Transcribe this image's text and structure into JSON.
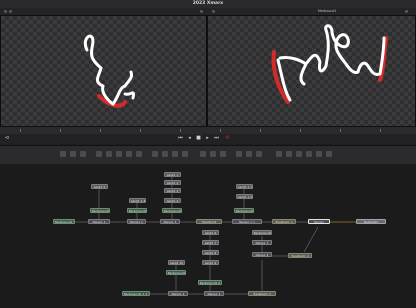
{
  "window": {
    "title": "2023 Xmarx"
  },
  "viewer2_label": "Mediaout1",
  "nodes": [
    {
      "id": "n1",
      "label": "paint1_1"
    },
    {
      "id": "n2",
      "label": "paint1_2"
    },
    {
      "id": "n3",
      "label": "paint1_3"
    },
    {
      "id": "n4",
      "label": "paint1_4"
    },
    {
      "id": "n5",
      "label": "paint1_5"
    },
    {
      "id": "n6",
      "label": "paint1_1_1"
    },
    {
      "id": "n7",
      "label": "paint1_1_2"
    },
    {
      "id": "n8",
      "label": "Background1_1"
    },
    {
      "id": "n9",
      "label": "Background1_2"
    },
    {
      "id": "n10",
      "label": "Background1_3"
    },
    {
      "id": "n11",
      "label": "Background1_4"
    },
    {
      "id": "n12",
      "label": "Background1_1_1"
    },
    {
      "id": "n13",
      "label": "Background1_1_1_1"
    },
    {
      "id": "n14",
      "label": "Merge1_1"
    },
    {
      "id": "n15",
      "label": "Merge1_2"
    },
    {
      "id": "n16",
      "label": "Merge1_3"
    },
    {
      "id": "n17",
      "label": "Merge1_1_1"
    },
    {
      "id": "n18",
      "label": "Transform1"
    },
    {
      "id": "n19",
      "label": "Transform1_1"
    },
    {
      "id": "n20",
      "label": "Merge1"
    },
    {
      "id": "n21",
      "label": "MediaOut1"
    },
    {
      "id": "n22",
      "label": "paint1_6"
    },
    {
      "id": "n23",
      "label": "paint1_7"
    },
    {
      "id": "n24",
      "label": "paint1_8"
    },
    {
      "id": "n25",
      "label": "paint1_9"
    },
    {
      "id": "n26",
      "label": "paint1_10"
    },
    {
      "id": "n27",
      "label": "Background1_5"
    },
    {
      "id": "n28",
      "label": "Background1_6"
    },
    {
      "id": "n29",
      "label": "paint1_1_3"
    },
    {
      "id": "n30",
      "label": "Merge1_4"
    },
    {
      "id": "n31",
      "label": "Transform1_2"
    },
    {
      "id": "n32",
      "label": "Background1_1_1_1_1"
    },
    {
      "id": "n33",
      "label": "Merge1_5"
    },
    {
      "id": "n34",
      "label": "Merge1_6"
    },
    {
      "id": "n35",
      "label": "Transform1_3"
    },
    {
      "id": "n36",
      "label": "Merge1_7"
    }
  ],
  "colors": {
    "stroke_white": "#ffffff",
    "stroke_red": "#d42a2a",
    "accent_red": "#c9302c"
  }
}
